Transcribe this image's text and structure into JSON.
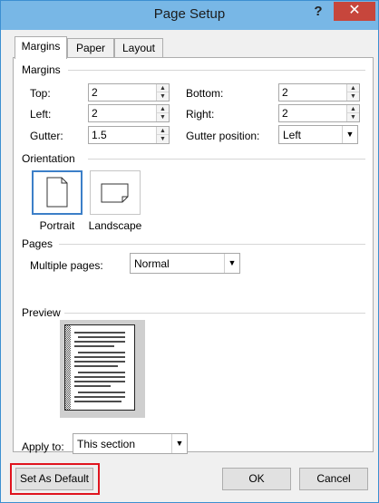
{
  "window": {
    "title": "Page Setup",
    "help_glyph": "?",
    "close_glyph": "✕"
  },
  "tabs": [
    {
      "label": "Margins",
      "active": true
    },
    {
      "label": "Paper",
      "active": false
    },
    {
      "label": "Layout",
      "active": false
    }
  ],
  "margins": {
    "group_label": "Margins",
    "top_label": "Top:",
    "top_value": "2",
    "bottom_label": "Bottom:",
    "bottom_value": "2",
    "left_label": "Left:",
    "left_value": "2",
    "right_label": "Right:",
    "right_value": "2",
    "gutter_label": "Gutter:",
    "gutter_value": "1.5",
    "gutter_position_label": "Gutter position:",
    "gutter_position_value": "Left"
  },
  "orientation": {
    "group_label": "Orientation",
    "portrait_label": "Portrait",
    "landscape_label": "Landscape",
    "selected": "portrait"
  },
  "pages": {
    "group_label": "Pages",
    "multiple_pages_label": "Multiple pages:",
    "multiple_pages_value": "Normal"
  },
  "preview": {
    "group_label": "Preview",
    "apply_to_label": "Apply to:",
    "apply_to_value": "This section"
  },
  "buttons": {
    "set_default": "Set As Default",
    "ok": "OK",
    "cancel": "Cancel"
  },
  "colors": {
    "titlebar": "#78b7e6",
    "close_button": "#c7463c",
    "selection_accent": "#3c7fc8",
    "highlight_box": "#e0141e"
  }
}
